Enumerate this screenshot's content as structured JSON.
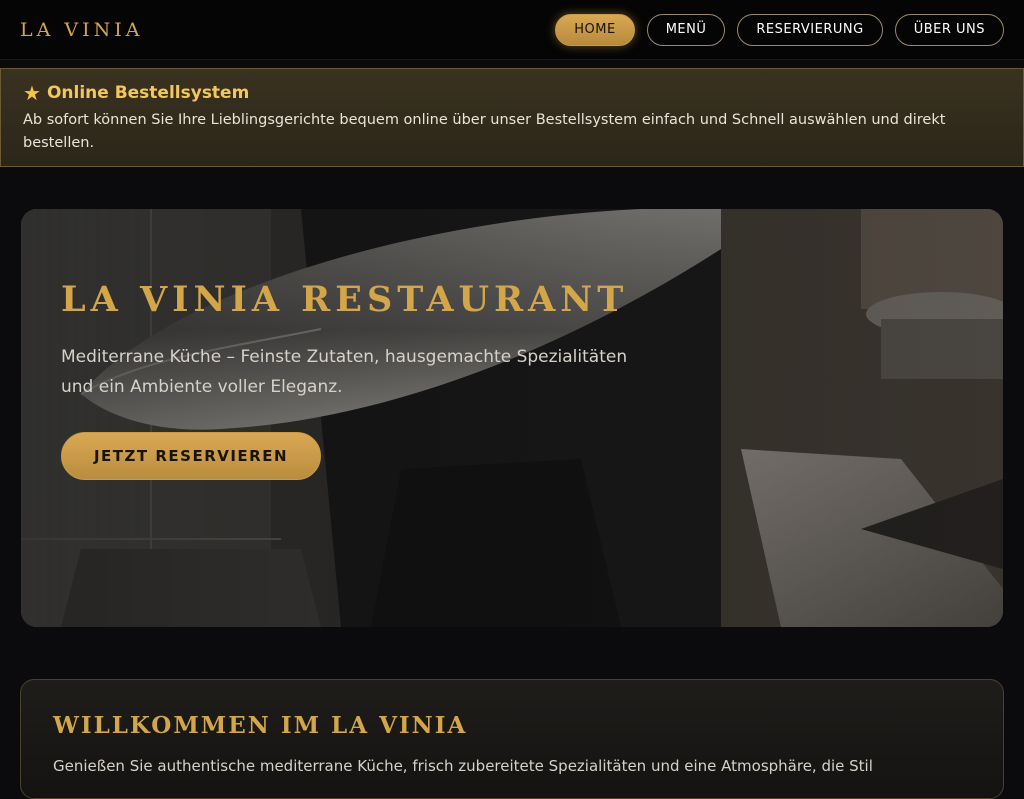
{
  "header": {
    "brand": "LA VINIA",
    "nav": [
      {
        "label": "HOME",
        "active": true
      },
      {
        "label": "MENÜ",
        "active": false
      },
      {
        "label": "RESERVIERUNG",
        "active": false
      },
      {
        "label": "ÜBER UNS",
        "active": false
      }
    ]
  },
  "notice": {
    "icon": "star-icon",
    "title": "Online Bestellsystem",
    "text": "Ab sofort können Sie Ihre Lieblingsgerichte bequem online über unser Bestellsystem einfach und Schnell auswählen und direkt bestellen."
  },
  "hero": {
    "title": "LA VINIA RESTAURANT",
    "subtitle": "Mediterrane Küche – Feinste Zutaten, hausgemachte Spezialitäten und ein Ambiente voller Eleganz.",
    "cta_label": "JETZT RESERVIEREN"
  },
  "welcome": {
    "title": "WILLKOMMEN IM LA VINIA",
    "text": "Genießen Sie authentische mediterrane Küche, frisch zubereitete Spezialitäten und eine Atmosphäre, die Stil"
  },
  "colors": {
    "accent_gold": "#d4a64a",
    "background": "#0b0b0d",
    "notice_bg": "#3a3220"
  }
}
